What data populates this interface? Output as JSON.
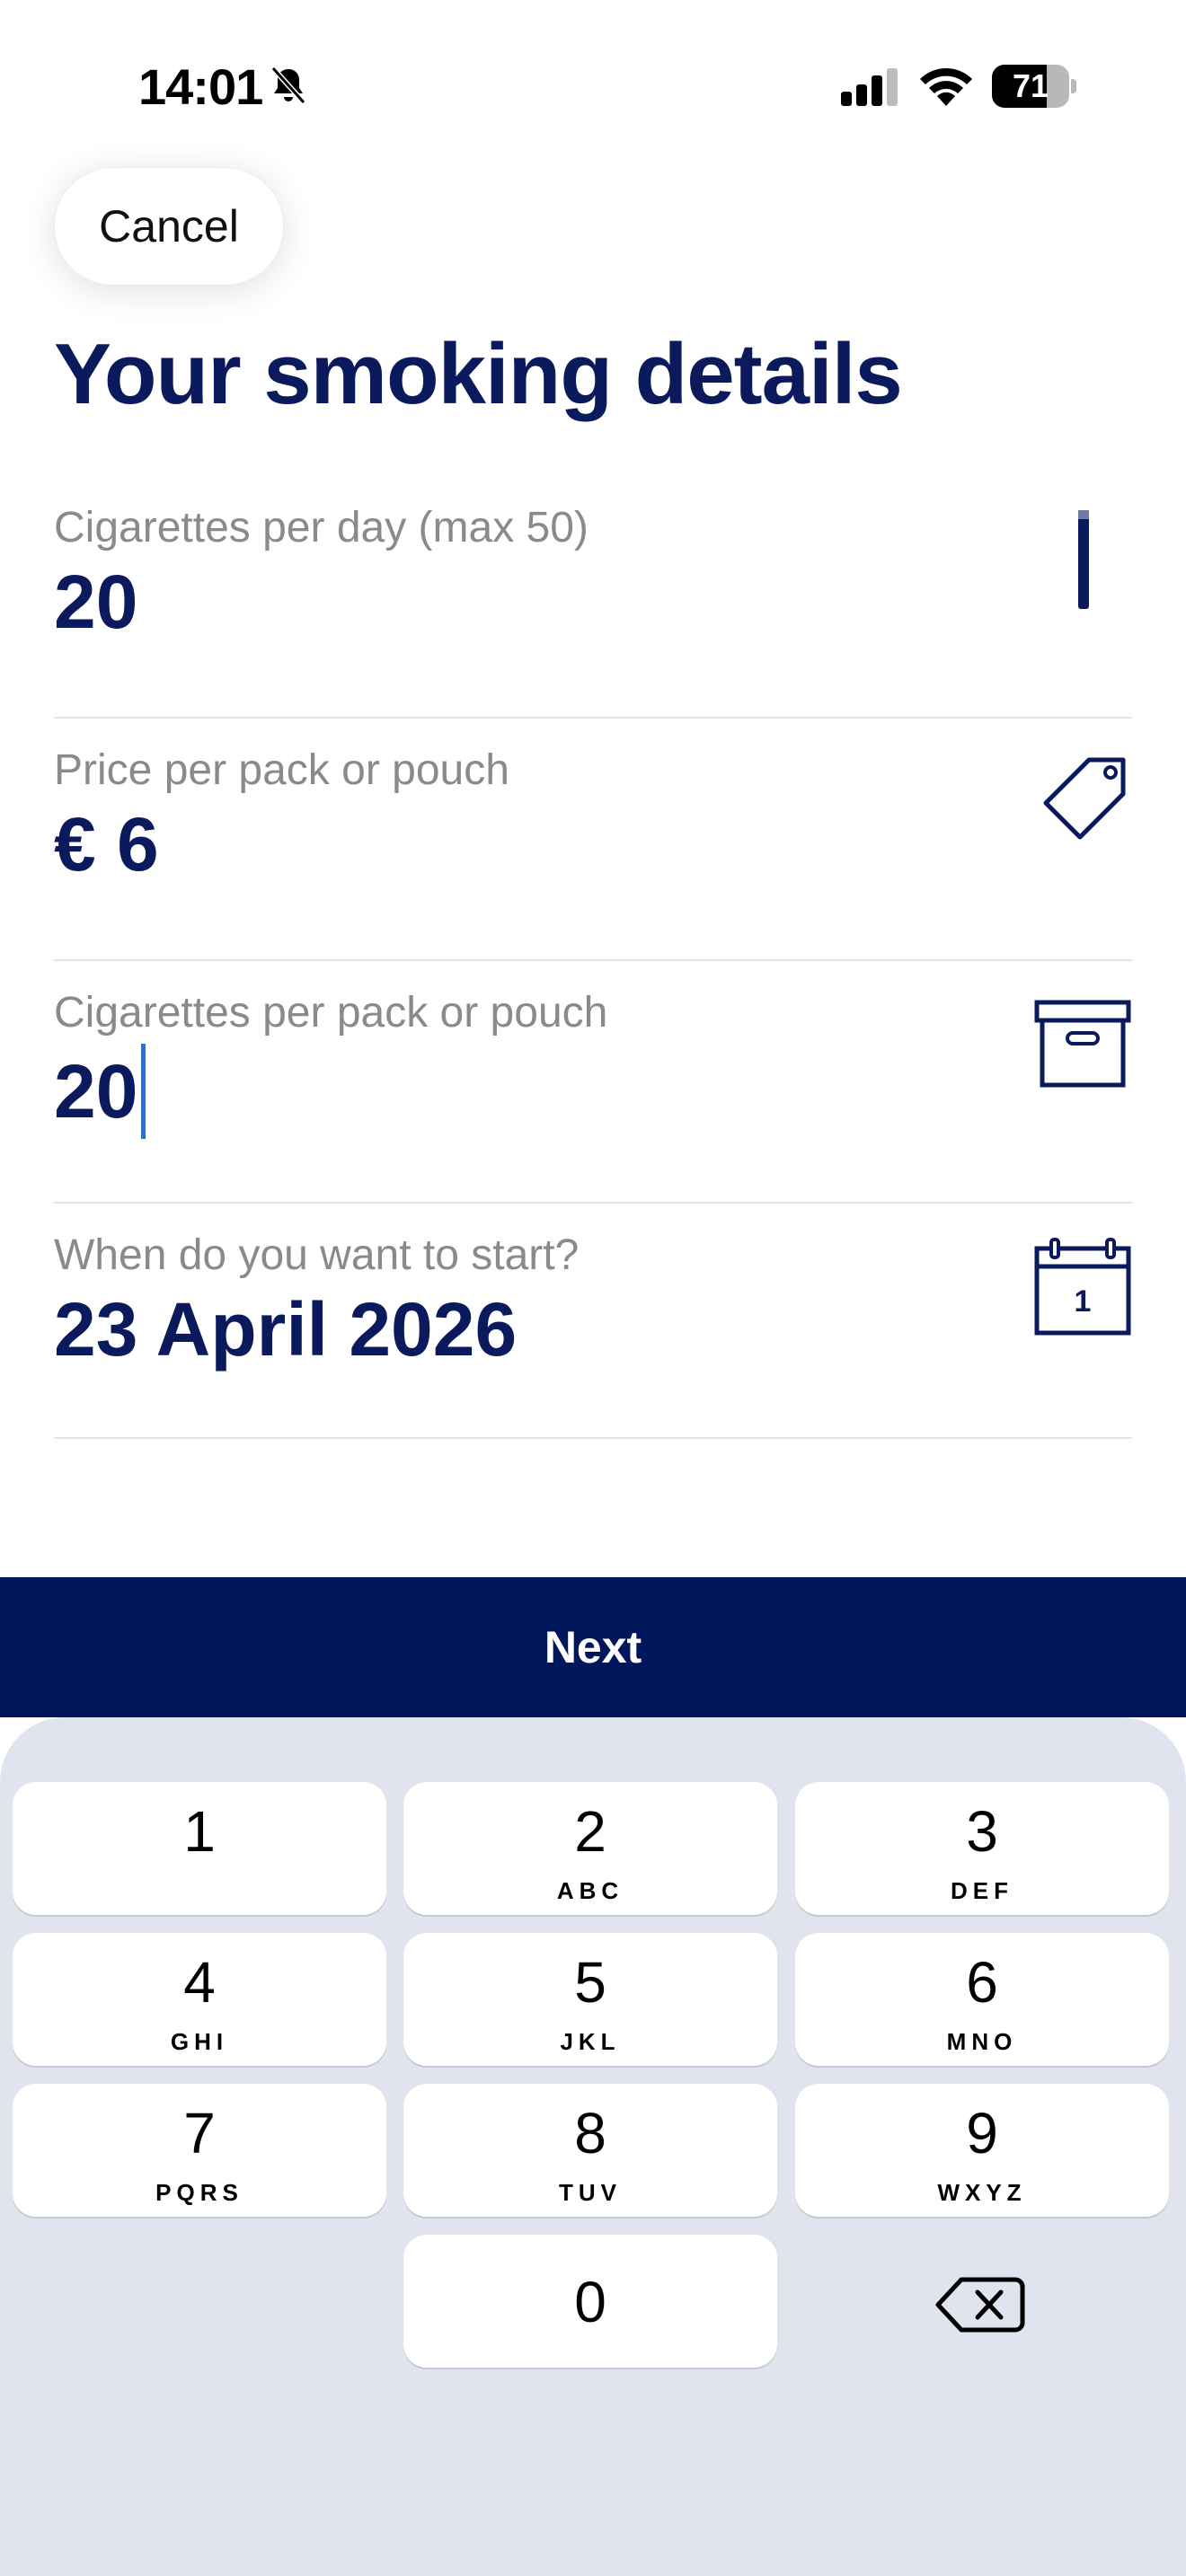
{
  "status_bar": {
    "time": "14:01",
    "battery": "71",
    "battery_level": 0.71,
    "icons": [
      "bell-slash-icon",
      "cellular-signal-icon",
      "wifi-icon",
      "battery-icon"
    ]
  },
  "header": {
    "cancel_label": "Cancel",
    "title": "Your smoking details"
  },
  "fields": [
    {
      "label": "Cigarettes per day (max 50)",
      "value": "20",
      "icon": "cigarette-icon"
    },
    {
      "label": "Price per pack or pouch",
      "value": "€ 6",
      "icon": "price-tag-icon"
    },
    {
      "label": "Cigarettes per pack or pouch",
      "value": "20",
      "icon": "box-icon",
      "focused": true
    },
    {
      "label": "When do you want to start?",
      "value": "23 April 2026",
      "icon": "calendar-icon",
      "icon_text": "1"
    }
  ],
  "next_label": "Next",
  "keypad": {
    "keys": [
      {
        "digit": "1",
        "letters": ""
      },
      {
        "digit": "2",
        "letters": "ABC"
      },
      {
        "digit": "3",
        "letters": "DEF"
      },
      {
        "digit": "4",
        "letters": "GHI"
      },
      {
        "digit": "5",
        "letters": "JKL"
      },
      {
        "digit": "6",
        "letters": "MNO"
      },
      {
        "digit": "7",
        "letters": "PQRS"
      },
      {
        "digit": "8",
        "letters": "TUV"
      },
      {
        "digit": "9",
        "letters": "WXYZ"
      },
      {
        "digit": "0",
        "letters": ""
      }
    ],
    "delete_icon": "backspace-icon"
  },
  "colors": {
    "primary": "#00175c",
    "title": "#0b1a5c",
    "label": "#8a8a8a",
    "caret": "#1a73e8",
    "keyboard_bg": "#e1e4ee"
  }
}
